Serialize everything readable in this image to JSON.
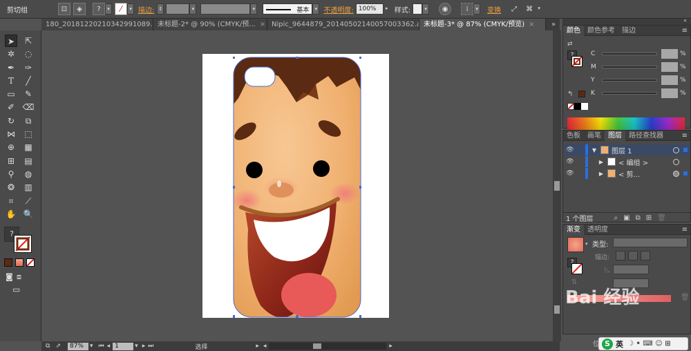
{
  "control_bar": {
    "title": "剪切组",
    "stroke_label": "描边:",
    "stroke_style": "基本",
    "opacity_label": "不透明度:",
    "opacity_value": "100%",
    "style_label": "样式:",
    "transform_label": "变换"
  },
  "tabs": [
    {
      "label": "180_20181220210342991089.ai*",
      "active": false
    },
    {
      "label": "未标题-2* @ 90% (CMYK/预...",
      "active": false
    },
    {
      "label": "Nipic_9644879_20140502140057003362.ai*",
      "active": false
    },
    {
      "label": "未标题-3* @ 87% (CMYK/预览)",
      "active": true
    }
  ],
  "tabs_close_glyph": "×",
  "tabs_overflow": "»",
  "toolbox": {
    "help_glyph": "?",
    "tools": [
      "selection-tool",
      "direct-selection-tool",
      "magic-wand-tool",
      "lasso-tool",
      "pen-tool",
      "curvature-tool",
      "type-tool",
      "line-tool",
      "rectangle-tool",
      "paintbrush-tool",
      "pencil-tool",
      "eraser-tool",
      "rotate-tool",
      "scale-tool",
      "width-tool",
      "free-transform-tool",
      "shape-builder-tool",
      "perspective-grid-tool",
      "mesh-tool",
      "gradient-tool",
      "eyedropper-tool",
      "blend-tool",
      "symbol-sprayer-tool",
      "column-graph-tool",
      "artboard-tool",
      "slice-tool",
      "hand-tool",
      "zoom-tool"
    ]
  },
  "status_bar": {
    "zoom": "87%",
    "page": "1",
    "tool": "选择"
  },
  "color_panel": {
    "tabs": [
      "颜色",
      "颜色参考",
      "描边"
    ],
    "active_tab": 0,
    "channels": [
      {
        "label": "C",
        "unit": "%"
      },
      {
        "label": "M",
        "unit": "%"
      },
      {
        "label": "Y",
        "unit": "%"
      },
      {
        "label": "K",
        "unit": "%"
      }
    ],
    "help_glyph": "?"
  },
  "layers_panel": {
    "tabs": [
      "色板",
      "画笔",
      "图层",
      "路径查找器"
    ],
    "active_tab": 2,
    "rows": [
      {
        "name": "图层 1",
        "indent": 0
      },
      {
        "name": "< 编组 >",
        "indent": 1
      },
      {
        "name": "< 剪... ",
        "indent": 1
      }
    ],
    "footer": "1 个图层"
  },
  "gradient_panel": {
    "tabs": [
      "渐变",
      "透明度"
    ],
    "active_tab": 0,
    "type_label": "类型:",
    "stroke_label": "描边:",
    "help_glyph": "?"
  },
  "ime": {
    "s_glyph": "S",
    "lang": "英",
    "glyphs": "☽ • ⌨ ☺ ⊞"
  },
  "watermark_text": "Bai 经验",
  "partial_text": "位置",
  "colors": {
    "ui_dark": "#4a4a4a",
    "canvas": "#535353",
    "accent_link": "#f0a040",
    "selection_blue": "#2a6ee0",
    "brown_hair": "#5a2a12",
    "skin": "#f0b878"
  }
}
